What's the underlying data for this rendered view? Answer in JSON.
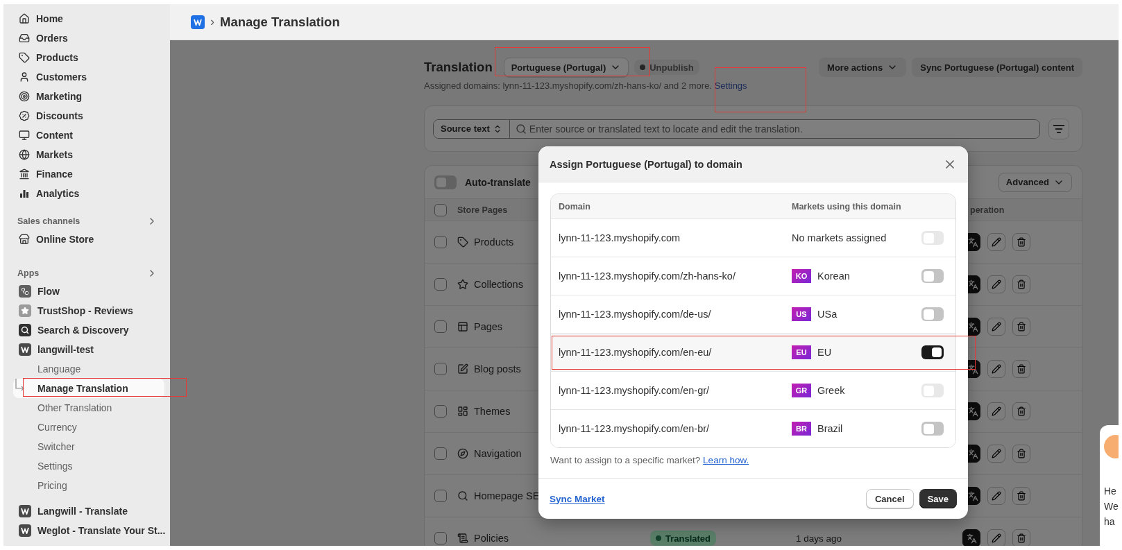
{
  "sidebar": {
    "items": [
      "Home",
      "Orders",
      "Products",
      "Customers",
      "Marketing",
      "Discounts",
      "Content",
      "Markets",
      "Finance",
      "Analytics"
    ],
    "sales_channels": {
      "title": "Sales channels",
      "items": [
        "Online Store"
      ]
    },
    "apps": {
      "title": "Apps",
      "items": [
        {
          "label": "Flow"
        },
        {
          "label": "TrustShop - Reviews"
        },
        {
          "label": "Search & Discovery"
        },
        {
          "label": "langwill-test",
          "children": [
            {
              "label": "Language",
              "selected": false
            },
            {
              "label": "Manage Translation",
              "selected": true
            },
            {
              "label": "Other Translation",
              "selected": false
            },
            {
              "label": "Currency",
              "selected": false
            },
            {
              "label": "Switcher",
              "selected": false
            },
            {
              "label": "Settings",
              "selected": false
            },
            {
              "label": "Pricing",
              "selected": false
            }
          ]
        },
        {
          "label": "Langwill - Translate"
        },
        {
          "label": "Weglot - Translate Your St..."
        }
      ]
    }
  },
  "header": {
    "separator": "›",
    "title": "Manage Translation"
  },
  "page": {
    "title": "Translation",
    "language": "Portuguese (Portugal)",
    "status": "Unpublish",
    "actions": [
      "More actions",
      "Sync Portuguese (Portugal) content"
    ],
    "assigned": "Assigned domains: lynn-11-123.myshopify.com/zh-hans-ko/ and 2 more.",
    "settings_link": "Settings"
  },
  "search": {
    "mode": "Source text",
    "placeholder": "Enter source or translated text to locate and edit the translation."
  },
  "table": {
    "auto_translate": {
      "label": "Auto-translate",
      "on": false
    },
    "select_all": {
      "checked": false
    },
    "advanced": "Advanced",
    "columns": [
      "Store Pages",
      "peration"
    ],
    "rows": [
      {
        "name": "Products",
        "checked": false
      },
      {
        "name": "Collections",
        "checked": false
      },
      {
        "name": "Pages",
        "checked": false
      },
      {
        "name": "Blog posts",
        "checked": false
      },
      {
        "name": "Themes",
        "checked": false
      },
      {
        "name": "Navigation",
        "checked": false
      },
      {
        "name": "Homepage SE",
        "checked": false
      },
      {
        "name": "Policies",
        "checked": false,
        "status": "Translated",
        "updated": "1 days ago"
      }
    ]
  },
  "dialog": {
    "title": "Assign Portuguese (Portugal) to domain",
    "columns": [
      "Domain",
      "Markets using this domain"
    ],
    "rows": [
      {
        "domain": "lynn-11-123.myshopify.com",
        "market": "No markets assigned",
        "on": false,
        "disabled": true
      },
      {
        "domain": "lynn-11-123.myshopify.com/zh-hans-ko/",
        "code": "KO",
        "market": "Korean",
        "on": false,
        "disabled": false
      },
      {
        "domain": "lynn-11-123.myshopify.com/de-us/",
        "code": "US",
        "market": "USa",
        "on": false,
        "disabled": false
      },
      {
        "domain": "lynn-11-123.myshopify.com/en-eu/",
        "code": "EU",
        "market": "EU",
        "on": true,
        "disabled": false
      },
      {
        "domain": "lynn-11-123.myshopify.com/en-gr/",
        "code": "GR",
        "market": "Greek",
        "on": false,
        "disabled": true
      },
      {
        "domain": "lynn-11-123.myshopify.com/en-br/",
        "code": "BR",
        "market": "Brazil",
        "on": false,
        "disabled": false
      }
    ],
    "hint": "Want to assign to a specific market?",
    "hint_link": "Learn how.",
    "sync": "Sync Market",
    "buttons": [
      "Cancel",
      "Save"
    ]
  },
  "chat": {
    "lines": [
      "He",
      "We",
      "ha"
    ]
  }
}
